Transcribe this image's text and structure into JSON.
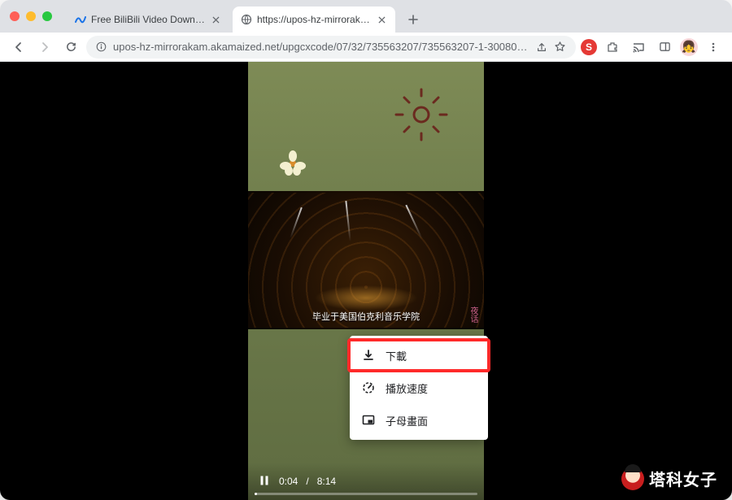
{
  "tabs": [
    {
      "title": "Free BiliBili Video Downloader",
      "favicon": "nd"
    },
    {
      "title": "https://upos-hz-mirrorakam.ak",
      "favicon": "globe",
      "active": true
    }
  ],
  "toolbar": {
    "url": "upos-hz-mirrorakam.akamaized.net/upgcxcode/07/32/735563207/735563207-1-30080.m4s?e=ig8euxZM2rNcN...",
    "share_icon": "share-icon",
    "star_icon": "star-icon",
    "ext_label": "S",
    "puzzle_icon": "extensions-icon",
    "cast_icon": "cast-icon",
    "sidepanel_icon": "sidepanel-icon",
    "avatar": "👧",
    "kebab_icon": "kebab-icon"
  },
  "video": {
    "caption": "毕业于美国伯克利音乐学院",
    "stamp": "夜话",
    "time_current": "0:04",
    "time_total": "8:14"
  },
  "menu": {
    "download": "下載",
    "speed": "播放速度",
    "pip": "子母畫面"
  },
  "watermark": "塔科女子"
}
